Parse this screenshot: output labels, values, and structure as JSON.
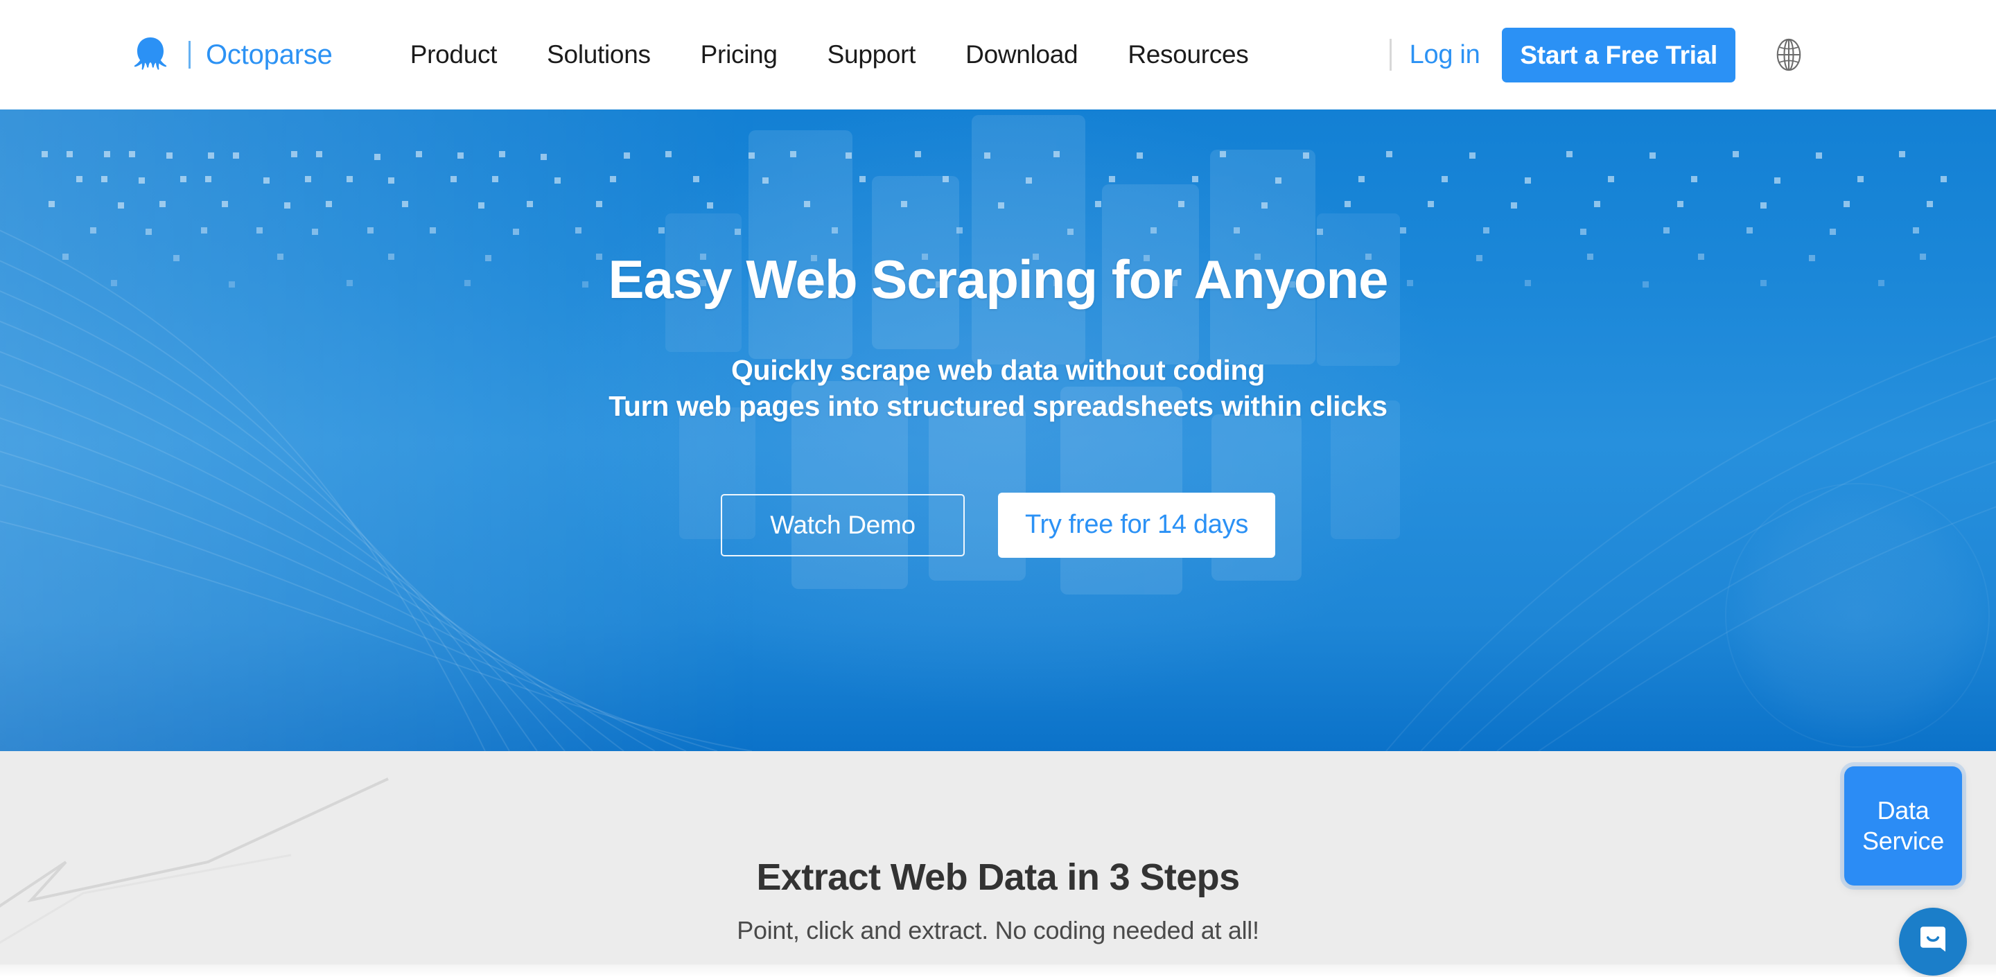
{
  "brand": {
    "name": "Octoparse",
    "logo_icon": "octopus-logo-icon"
  },
  "nav": {
    "items": [
      {
        "label": "Product"
      },
      {
        "label": "Solutions"
      },
      {
        "label": "Pricing"
      },
      {
        "label": "Support"
      },
      {
        "label": "Download"
      },
      {
        "label": "Resources"
      }
    ]
  },
  "header_actions": {
    "login_label": "Log in",
    "trial_label": "Start a Free Trial",
    "language_icon": "globe-icon"
  },
  "hero": {
    "title": "Easy Web Scraping for Anyone",
    "subtitle_line1": "Quickly scrape web data without coding",
    "subtitle_line2": "Turn web pages into structured spreadsheets within clicks",
    "watch_demo_label": "Watch Demo",
    "try_free_label": "Try free for 14 days"
  },
  "steps": {
    "title": "Extract Web Data in 3 Steps",
    "subtitle": "Point, click and extract. No coding needed at all!"
  },
  "widgets": {
    "data_service_line1": "Data",
    "data_service_line2": "Service",
    "chat_icon": "chat-bubble-icon"
  },
  "colors": {
    "brand_blue": "#2c92f4",
    "button_blue": "#2b91f5",
    "hero_blue": "#1b87d8",
    "hero_blue_dark": "#0b72c9",
    "section_gray": "#ececec",
    "text_dark": "#1b1b1b",
    "heading_gray": "#333333",
    "chat_blue": "#1b7ec9"
  }
}
